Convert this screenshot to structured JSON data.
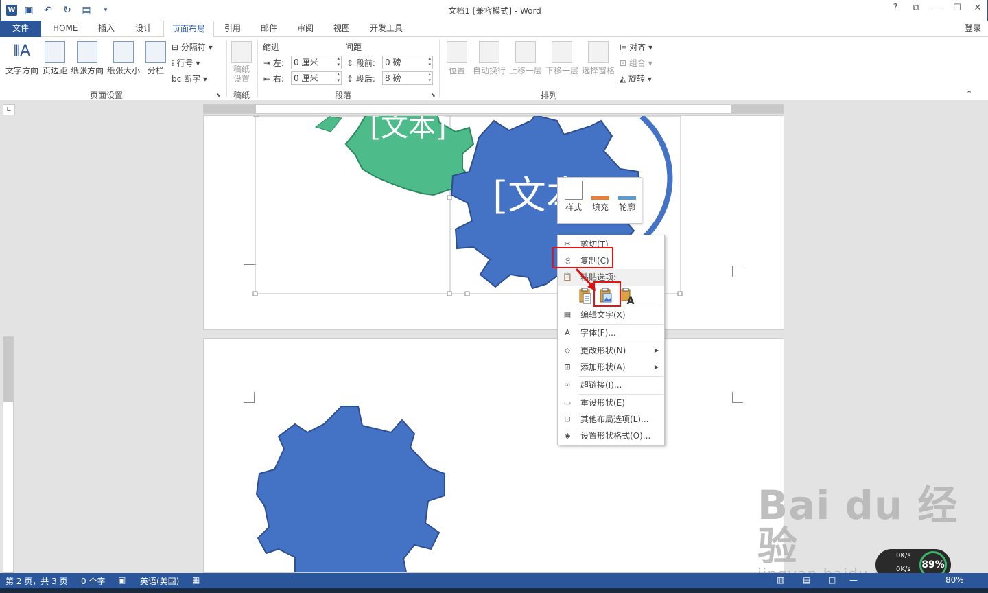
{
  "titlebar": {
    "title": "文档1 [兼容模式] - Word",
    "help_label": "?",
    "restore_label": "⧉",
    "minimize_label": "—",
    "maximize_label": "☐",
    "close_label": "✕"
  },
  "tabs": {
    "file": "文件",
    "home": "HOME",
    "insert": "插入",
    "design": "设计",
    "layout": "页面布局",
    "references": "引用",
    "mailings": "邮件",
    "review": "审阅",
    "view": "视图",
    "developer": "开发工具",
    "login": "登录"
  },
  "ribbon": {
    "page_setup": {
      "group_label": "页面设置",
      "text_direction": "文字方向",
      "margins": "页边距",
      "orientation": "纸张方向",
      "size": "纸张大小",
      "columns": "分栏",
      "breaks": "分隔符",
      "line_numbers": "行号",
      "hyphenation": "断字"
    },
    "manuscript": {
      "group_label": "稿纸",
      "settings": "稿纸设置"
    },
    "paragraph": {
      "group_label": "段落",
      "indent_label": "缩进",
      "spacing_label": "间距",
      "left_label": "左:",
      "left_value": "0 厘米",
      "right_label": "右:",
      "right_value": "0 厘米",
      "before_label": "段前:",
      "before_value": "0 磅",
      "after_label": "段后:",
      "after_value": "8 磅"
    },
    "arrange": {
      "group_label": "排列",
      "position": "位置",
      "wrap_text": "自动换行",
      "bring_forward": "上移一层",
      "send_backward": "下移一层",
      "selection_pane": "选择窗格",
      "align": "对齐",
      "group": "组合",
      "rotate": "旋转"
    }
  },
  "document": {
    "gear_green_text": "[文本]",
    "gear_blue_text": "[文本]"
  },
  "minibar": {
    "style": "样式",
    "fill": "填充",
    "outline": "轮廓"
  },
  "context_menu": {
    "cut": "剪切(T)",
    "copy": "复制(C)",
    "paste_options": "粘贴选项:",
    "edit_text": "编辑文字(X)",
    "font": "字体(F)...",
    "change_shape": "更改形状(N)",
    "add_shape": "添加形状(A)",
    "hyperlink": "超链接(I)...",
    "reset_shape": "重设形状(E)",
    "more_layout": "其他布局选项(L)...",
    "format_shape": "设置形状格式(O)..."
  },
  "statusbar": {
    "page": "第 2 页，共 3 页",
    "words": "0 个字",
    "language": "英语(美国)",
    "zoom": "80%"
  },
  "overlay": {
    "watermark_big": "Bai du 经验",
    "watermark_url": "jingyan.baidu.com",
    "speed_percent": "89%",
    "speed_up": "0K/s",
    "speed_down": "0K/s"
  },
  "colors": {
    "accent": "#2b579a",
    "gear_blue": "#4472c4",
    "gear_green": "#4dbb8a",
    "highlight_red": "#e11111"
  }
}
